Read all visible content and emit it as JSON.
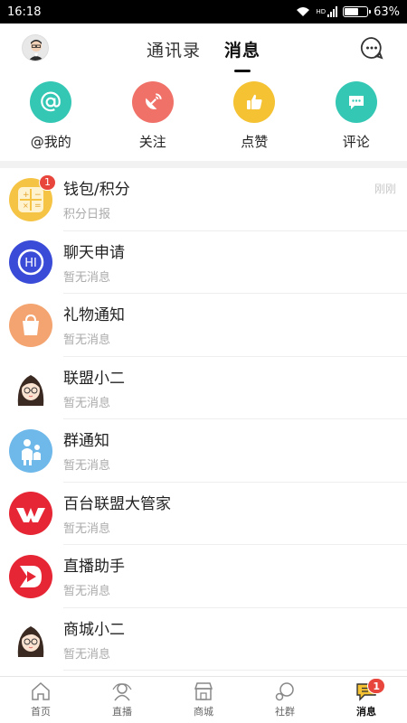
{
  "status": {
    "time": "16:18",
    "battery": "63%",
    "battery_level": 0.63,
    "hd": "HD"
  },
  "header": {
    "tabs": [
      {
        "label": "通讯录"
      },
      {
        "label": "消息"
      }
    ]
  },
  "quick_actions": [
    {
      "label": "@我的",
      "color": "#34c7b4",
      "icon": "at-icon"
    },
    {
      "label": "关注",
      "color": "#f07168",
      "icon": "satellite-dish-icon"
    },
    {
      "label": "点赞",
      "color": "#f4c232",
      "icon": "thumbs-up-icon"
    },
    {
      "label": "评论",
      "color": "#34c7b4",
      "icon": "comment-icon"
    }
  ],
  "messages": [
    {
      "title": "钱包/积分",
      "sub": "积分日报",
      "time": "刚刚",
      "badge": "1",
      "icon": "wallet-icon",
      "color": "#f6c445"
    },
    {
      "title": "聊天申请",
      "sub": "暂无消息",
      "time": "",
      "badge": "",
      "icon": "chat-request-icon",
      "color": "#3a4bd8"
    },
    {
      "title": "礼物通知",
      "sub": "暂无消息",
      "time": "",
      "badge": "",
      "icon": "gift-icon",
      "color": "#f4a470"
    },
    {
      "title": "联盟小二",
      "sub": "暂无消息",
      "time": "",
      "badge": "",
      "icon": "girl-avatar-icon",
      "color": "#ffffff"
    },
    {
      "title": "群通知",
      "sub": "暂无消息",
      "time": "",
      "badge": "",
      "icon": "group-icon",
      "color": "#6fb8ea"
    },
    {
      "title": "百台联盟大管家",
      "sub": "暂无消息",
      "time": "",
      "badge": "",
      "icon": "w-logo-icon",
      "color": "#e62634"
    },
    {
      "title": "直播助手",
      "sub": "暂无消息",
      "time": "",
      "badge": "",
      "icon": "live-icon",
      "color": "#e62634"
    },
    {
      "title": "商城小二",
      "sub": "暂无消息",
      "time": "",
      "badge": "",
      "icon": "girl-avatar-icon",
      "color": "#ffffff"
    }
  ],
  "bottom_nav": [
    {
      "label": "首页",
      "icon": "home-icon"
    },
    {
      "label": "直播",
      "icon": "live-people-icon"
    },
    {
      "label": "商城",
      "icon": "shop-icon"
    },
    {
      "label": "社群",
      "icon": "community-icon"
    },
    {
      "label": "消息",
      "icon": "message-icon",
      "badge": "1"
    }
  ]
}
